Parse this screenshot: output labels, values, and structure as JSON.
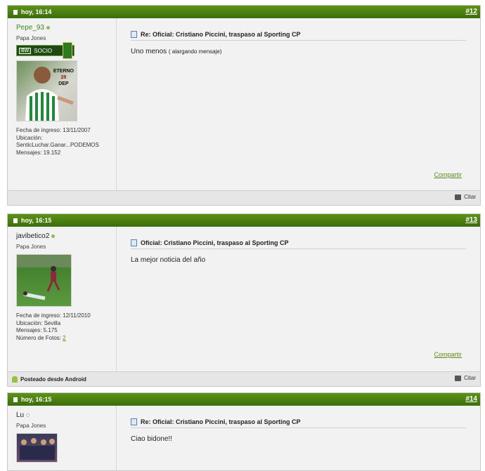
{
  "posts": [
    {
      "time": "hoy, 16:14",
      "number": "#12",
      "username": "Pepe_93",
      "online": true,
      "usertitle": "Papa Jones",
      "badge": {
        "bw": "BW",
        "text": "SOCIO"
      },
      "avatar_text": [
        "ETERNO",
        "28",
        "DEP"
      ],
      "fields": [
        "Fecha de ingreso: 13/11/2007",
        "Ubicación:",
        "SenticLuchar.Ganar...PODEMOS",
        "Mensajes:  19.152"
      ],
      "title": "Re: Oficial: Cristiano Piccini, traspaso al Sporting CP",
      "message": "Uno menos",
      "message_small": "( alargando mensaje)",
      "share": "Compartir",
      "quote": "Citar"
    },
    {
      "time": "hoy, 16:15",
      "number": "#13",
      "username": "javibetico2",
      "online": true,
      "usertitle": "Papa Jones",
      "fields": [
        "Fecha de ingreso: 12/11/2010",
        "Ubicación:  Sevilla",
        "Mensajes:  5.175"
      ],
      "photos_label": "Número de Fotos:",
      "photos_value": "2",
      "title": "Oficial: Cristiano Piccini, traspaso al Sporting CP",
      "message": "La mejor noticia del año",
      "share": "Compartir",
      "posted_from": "Posteado desde Android",
      "quote": "Citar"
    },
    {
      "time": "hoy, 16:15",
      "number": "#14",
      "username": "Lu",
      "online": false,
      "usertitle": "Papa Jones",
      "title": "Re: Oficial: Cristiano Piccini, traspaso al Sporting CP",
      "message": "Ciao bidone!!"
    }
  ],
  "colors": {
    "header_green": "#4a7f12",
    "online": "#7fc45a",
    "offline": "#bbbbbb",
    "link_green": "#5b8a1a",
    "username_green": "#3d8a1f"
  }
}
